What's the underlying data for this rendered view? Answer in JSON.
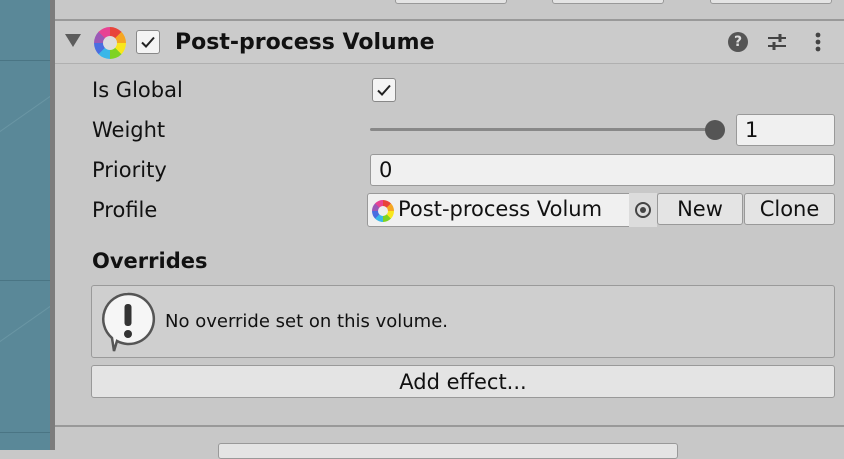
{
  "component": {
    "title": "Post-process Volume",
    "enabled": true,
    "icon": "post-process-volume-icon"
  },
  "fields": {
    "is_global": {
      "label": "Is Global",
      "checked": true
    },
    "weight": {
      "label": "Weight",
      "value": "1",
      "slider_fraction": 1.0
    },
    "priority": {
      "label": "Priority",
      "value": "0"
    },
    "profile": {
      "label": "Profile",
      "value": "Post-process Volum",
      "new_label": "New",
      "clone_label": "Clone"
    }
  },
  "overrides": {
    "title": "Overrides",
    "message": "No override set on this volume.",
    "add_effect_label": "Add effect..."
  },
  "colors": {
    "scene_bg": "#5a8898",
    "inspector_bg": "#c8c8c8"
  }
}
